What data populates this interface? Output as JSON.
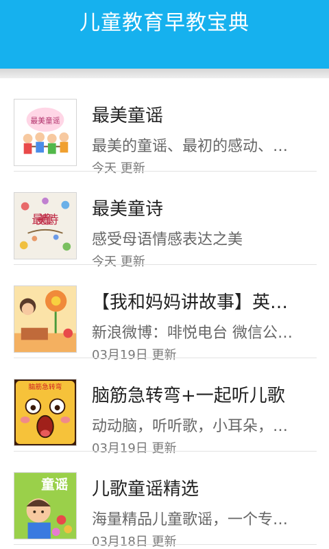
{
  "header": {
    "title": "儿童教育早教宝典",
    "bg_color": "#16b1ee"
  },
  "items": [
    {
      "title": "最美童谣",
      "desc": "最美的童谣、最初的感动、…",
      "meta": "今天 更新",
      "icon": "kids-holding-hands-thumbnail",
      "icon_text": "最美童谣"
    },
    {
      "title": "最美童诗",
      "desc": "感受母语情感表达之美",
      "meta": "今天 更新",
      "icon": "kids-poem-thumbnail",
      "icon_text": "最美童诗"
    },
    {
      "title": "【我和妈妈讲故事】英…",
      "desc": "新浪微博：啡悦电台 微信公…",
      "meta": "03月19日 更新",
      "icon": "girl-with-flower-thumbnail",
      "icon_text": ""
    },
    {
      "title": "脑筋急转弯+一起听儿歌",
      "desc": "动动脑，听听歌，小耳朵，…",
      "meta": "03月19日 更新",
      "icon": "surprised-face-thumbnail",
      "icon_text": "脑筋急转弯"
    },
    {
      "title": "儿歌童谣精选",
      "desc": "海量精品儿童歌谣，一个专…",
      "meta": "03月18日 更新",
      "icon": "child-with-flowers-thumbnail",
      "icon_text": "童谣"
    }
  ]
}
